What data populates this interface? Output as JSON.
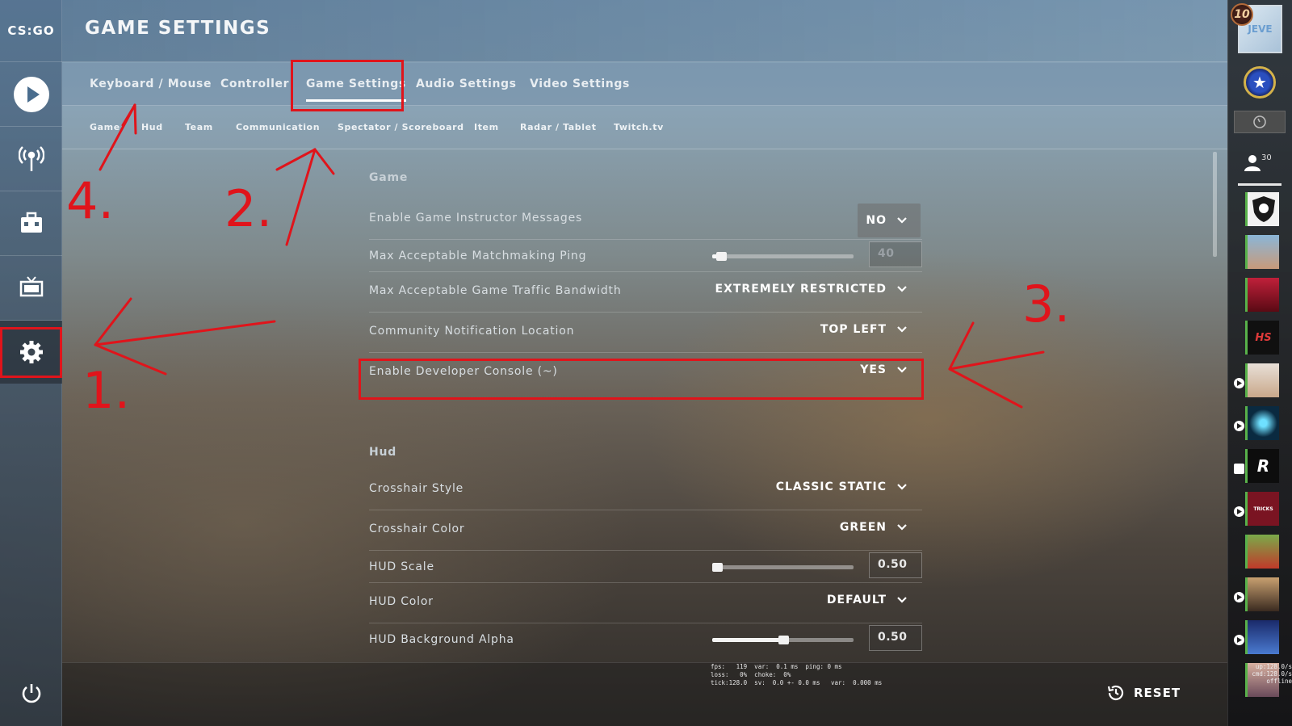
{
  "app": {
    "logo": "CS:GO"
  },
  "header": {
    "title": "GAME SETTINGS"
  },
  "tabs": [
    {
      "label": "Keyboard / Mouse"
    },
    {
      "label": "Controller"
    },
    {
      "label": "Game Settings",
      "active": true
    },
    {
      "label": "Audio Settings"
    },
    {
      "label": "Video Settings"
    }
  ],
  "subtabs": [
    {
      "label": "Game"
    },
    {
      "label": "Hud"
    },
    {
      "label": "Team"
    },
    {
      "label": "Communication"
    },
    {
      "label": "Spectator / Scoreboard"
    },
    {
      "label": "Item"
    },
    {
      "label": "Radar / Tablet"
    },
    {
      "label": "Twitch.tv"
    }
  ],
  "leftnav": {
    "items": [
      {
        "icon": "play-icon"
      },
      {
        "icon": "broadcast-icon"
      },
      {
        "icon": "inventory-icon"
      },
      {
        "icon": "tv-icon"
      },
      {
        "icon": "gear-icon",
        "active": true
      },
      {
        "icon": "power-icon"
      }
    ]
  },
  "sections": {
    "game": {
      "title": "Game",
      "rows": [
        {
          "label": "Enable Game Instructor Messages",
          "type": "dropdown",
          "value": "NO"
        },
        {
          "label": "Max Acceptable Matchmaking Ping",
          "type": "slider",
          "value": "40",
          "fraction": 0.05
        },
        {
          "label": "Max Acceptable Game Traffic Bandwidth",
          "type": "dropdown",
          "value": "EXTREMELY RESTRICTED"
        },
        {
          "label": "Community Notification Location",
          "type": "dropdown",
          "value": "TOP LEFT"
        },
        {
          "label": "Enable Developer Console (~)",
          "type": "dropdown",
          "value": "YES"
        }
      ]
    },
    "hud": {
      "title": "Hud",
      "rows": [
        {
          "label": "Crosshair Style",
          "type": "dropdown",
          "value": "CLASSIC STATIC"
        },
        {
          "label": "Crosshair Color",
          "type": "dropdown",
          "value": "GREEN"
        },
        {
          "label": "HUD Scale",
          "type": "slider",
          "value": "0.50",
          "fraction": 0.0
        },
        {
          "label": "HUD Color",
          "type": "dropdown",
          "value": "DEFAULT"
        },
        {
          "label": "HUD Background Alpha",
          "type": "slider",
          "value": "0.50",
          "fraction": 0.5
        }
      ]
    }
  },
  "footer": {
    "reset_label": "RESET",
    "netgraph": [
      "fps:   119  var:  0.1 ms  ping: 0 ms",
      "loss:   0%  choke:  0%",
      "tick:128.0  sv:  0.0 +- 0.0 ms   var:  0.000 ms"
    ]
  },
  "rightpanel": {
    "level": "10",
    "avatar_text": "JEVE",
    "friends_count": "30",
    "side_netgraph": [
      "up:128.0/s",
      "cmd:128.0/s",
      "offline"
    ],
    "friends": [
      {
        "icon": "shield-avatar",
        "text": ""
      },
      {
        "icon": "face-avatar",
        "text": ""
      },
      {
        "icon": "red-avatar",
        "text": ""
      },
      {
        "icon": "hs-avatar",
        "text": "HS"
      },
      {
        "icon": "girl-avatar",
        "text": ""
      },
      {
        "icon": "eye-avatar",
        "text": ""
      },
      {
        "icon": "r-avatar",
        "text": "R"
      },
      {
        "icon": "tricks-avatar",
        "text": "TRICKS"
      },
      {
        "icon": "frog-avatar",
        "text": ""
      },
      {
        "icon": "person-avatar",
        "text": ""
      },
      {
        "icon": "team-avatar",
        "text": ""
      },
      {
        "icon": "anime-avatar",
        "text": ""
      }
    ]
  },
  "annotations": {
    "n1": "1.",
    "n2": "2.",
    "n3": "3.",
    "n4": "4."
  },
  "colors": {
    "annotation": "#e0141b",
    "friend_online": "#58b14a"
  }
}
